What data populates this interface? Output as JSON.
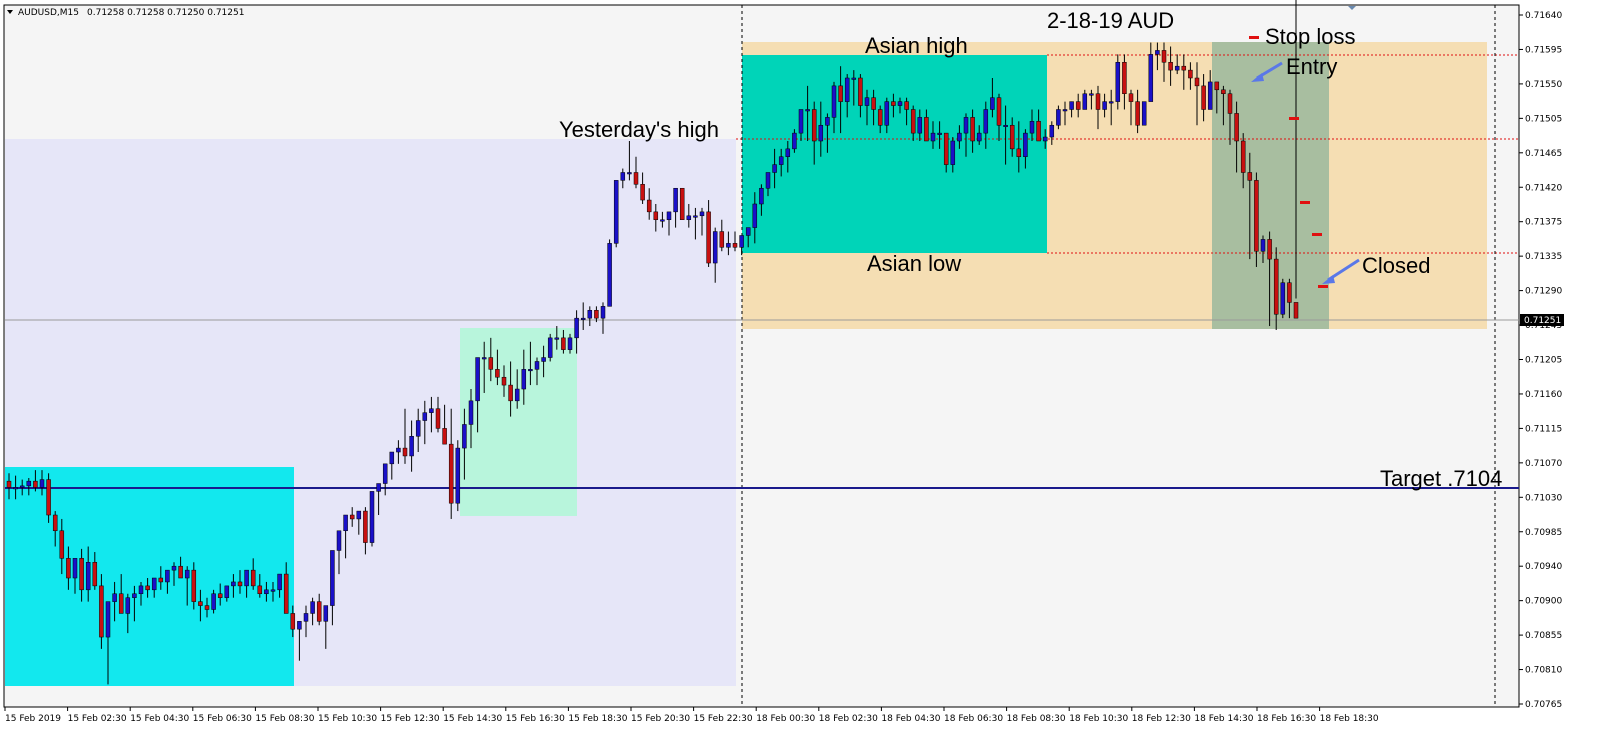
{
  "window": {
    "symbol_label": "AUDUSD,M15",
    "ohlc_label": "0.71258 0.71258 0.71250 0.71251",
    "current_price_label": "0.71251"
  },
  "chart_data": {
    "type": "candlestick",
    "symbol": "AUDUSD",
    "timeframe": "M15",
    "title": "2-18-19  AUD",
    "ylim": [
      0.7075,
      0.71665
    ],
    "y_ticks": [
      "0.71640",
      "0.71595",
      "0.71550",
      "0.71505",
      "0.71465",
      "0.71420",
      "0.71375",
      "0.71335",
      "0.71290",
      "0.71245",
      "0.71205",
      "0.71160",
      "0.71115",
      "0.71070",
      "0.71030",
      "0.70985",
      "0.70940",
      "0.70900",
      "0.70855",
      "0.70810",
      "0.70765"
    ],
    "x_tick_labels": [
      "15 Feb 2019",
      "15 Feb 02:30",
      "15 Feb 04:30",
      "15 Feb 06:30",
      "15 Feb 08:30",
      "15 Feb 10:30",
      "15 Feb 12:30",
      "15 Feb 14:30",
      "15 Feb 16:30",
      "15 Feb 18:30",
      "15 Feb 20:30",
      "15 Feb 22:30",
      "18 Feb 00:30",
      "18 Feb 02:30",
      "18 Feb 04:30",
      "18 Feb 06:30",
      "18 Feb 08:30",
      "18 Feb 10:30",
      "18 Feb 12:30",
      "18 Feb 14:30",
      "18 Feb 16:30",
      "18 Feb 18:30"
    ],
    "candles": {
      "o": [
        0.71048,
        0.7104,
        0.7104,
        0.71042,
        0.71048,
        0.7104,
        0.7105,
        0.71005,
        0.70985,
        0.7095,
        0.70925,
        0.7095,
        0.7091,
        0.70945,
        0.70915,
        0.7085,
        0.70895,
        0.70905,
        0.7088,
        0.709,
        0.70905,
        0.70915,
        0.7091,
        0.70925,
        0.7092,
        0.70935,
        0.7094,
        0.70925,
        0.70935,
        0.70895,
        0.7089,
        0.70885,
        0.70905,
        0.709,
        0.70915,
        0.7092,
        0.70915,
        0.70935,
        0.70915,
        0.70905,
        0.7091,
        0.7091,
        0.7093,
        0.7088,
        0.7086,
        0.7087,
        0.7088,
        0.70895,
        0.7087,
        0.7089,
        0.7096,
        0.70985,
        0.71005,
        0.71,
        0.7101,
        0.7097,
        0.71035,
        0.71045,
        0.7107,
        0.71085,
        0.7109,
        0.7108,
        0.71105,
        0.71125,
        0.71135,
        0.7114,
        0.71115,
        0.71095,
        0.7102,
        0.7109,
        0.7112,
        0.7115,
        0.71205,
        0.71205,
        0.7119,
        0.7118,
        0.7117,
        0.7115,
        0.71165,
        0.7119,
        0.7119,
        0.712,
        0.71205,
        0.7123,
        0.7123,
        0.71215,
        0.7123,
        0.71255,
        0.71255,
        0.71265,
        0.71255,
        0.7127,
        0.7135,
        0.7143,
        0.7144,
        0.7144,
        0.71425,
        0.71405,
        0.7139,
        0.7138,
        0.7138,
        0.7139,
        0.7142,
        0.7138,
        0.71385,
        0.71385,
        0.7139,
        0.71325,
        0.71365,
        0.71345,
        0.7135,
        0.71345,
        0.7136,
        0.7137,
        0.714,
        0.7142,
        0.7144,
        0.7145,
        0.7146,
        0.7147,
        0.7149,
        0.7152,
        0.7152,
        0.7148,
        0.715,
        0.7151,
        0.7155,
        0.7153,
        0.7156,
        0.7156,
        0.71525,
        0.71535,
        0.7152,
        0.715,
        0.7153,
        0.71525,
        0.7153,
        0.7152,
        0.7149,
        0.7151,
        0.7148,
        0.7149,
        0.7149,
        0.7145,
        0.7148,
        0.7149,
        0.7151,
        0.7148,
        0.7149,
        0.7152,
        0.71535,
        0.715,
        0.715,
        0.7147,
        0.7146,
        0.7149,
        0.71505,
        0.7148,
        0.71485,
        0.715,
        0.7152,
        0.7152,
        0.7153,
        0.7152,
        0.7154,
        0.7154,
        0.7152,
        0.7153,
        0.7153,
        0.7158,
        0.7154,
        0.7153,
        0.715,
        0.7153,
        0.7159,
        0.71595,
        0.7158,
        0.7157,
        0.71575,
        0.7157,
        0.7156,
        0.7155,
        0.7152,
        0.71555,
        0.71545,
        0.7154,
        0.71515,
        0.7148,
        0.7144,
        0.7143,
        0.7134,
        0.71355,
        0.7133,
        0.7126,
        0.713,
        0.71275
      ],
      "h": [
        0.71058,
        0.71055,
        0.7105,
        0.71052,
        0.71062,
        0.71062,
        0.71058,
        0.7101,
        0.71,
        0.70965,
        0.70935,
        0.70962,
        0.70965,
        0.70958,
        0.7093,
        0.7088,
        0.7092,
        0.7093,
        0.70905,
        0.70915,
        0.7092,
        0.70925,
        0.70925,
        0.7094,
        0.70935,
        0.70945,
        0.70952,
        0.7094,
        0.70945,
        0.7091,
        0.709,
        0.7091,
        0.70918,
        0.70915,
        0.7093,
        0.70935,
        0.7093,
        0.7095,
        0.7093,
        0.7092,
        0.7092,
        0.70925,
        0.70945,
        0.7089,
        0.7087,
        0.7089,
        0.709,
        0.70905,
        0.70885,
        0.70905,
        0.70975,
        0.71005,
        0.71015,
        0.7101,
        0.71015,
        0.7101,
        0.71045,
        0.7106,
        0.71085,
        0.711,
        0.7114,
        0.71125,
        0.7114,
        0.7115,
        0.71155,
        0.71155,
        0.71145,
        0.7114,
        0.711,
        0.7114,
        0.71165,
        0.712,
        0.71225,
        0.7123,
        0.71215,
        0.71195,
        0.712,
        0.7119,
        0.71215,
        0.71225,
        0.71205,
        0.7122,
        0.71235,
        0.71245,
        0.7124,
        0.71235,
        0.71265,
        0.71275,
        0.7127,
        0.7127,
        0.71275,
        0.71355,
        0.7143,
        0.71445,
        0.7148,
        0.7146,
        0.7144,
        0.7142,
        0.714,
        0.7139,
        0.7139,
        0.7142,
        0.7142,
        0.714,
        0.71395,
        0.71395,
        0.71405,
        0.7137,
        0.7138,
        0.71365,
        0.71365,
        0.7136,
        0.7137,
        0.71415,
        0.71425,
        0.7144,
        0.7147,
        0.7147,
        0.7148,
        0.71495,
        0.7152,
        0.7155,
        0.7153,
        0.7153,
        0.71515,
        0.71555,
        0.71575,
        0.71565,
        0.7157,
        0.71565,
        0.71545,
        0.71545,
        0.71525,
        0.71535,
        0.7154,
        0.71535,
        0.71535,
        0.71525,
        0.7152,
        0.7152,
        0.71505,
        0.71505,
        0.7149,
        0.71485,
        0.715,
        0.71515,
        0.7152,
        0.715,
        0.7153,
        0.7156,
        0.7154,
        0.71525,
        0.7151,
        0.71505,
        0.71495,
        0.7152,
        0.7152,
        0.71495,
        0.71505,
        0.71525,
        0.7153,
        0.7153,
        0.7154,
        0.71545,
        0.71545,
        0.7155,
        0.7154,
        0.71545,
        0.7159,
        0.7159,
        0.71545,
        0.71545,
        0.7153,
        0.71605,
        0.71605,
        0.71605,
        0.716,
        0.7159,
        0.7159,
        0.7158,
        0.7158,
        0.71565,
        0.7157,
        0.71555,
        0.7155,
        0.71545,
        0.7153,
        0.7149,
        0.71465,
        0.7144,
        0.7136,
        0.71365,
        0.71345,
        0.71305,
        0.71305,
        0.7128
      ],
      "l": [
        0.71025,
        0.71025,
        0.7103,
        0.7103,
        0.71035,
        0.7103,
        0.70995,
        0.70965,
        0.7093,
        0.7091,
        0.70905,
        0.70895,
        0.70895,
        0.7091,
        0.70835,
        0.7079,
        0.7087,
        0.7089,
        0.70855,
        0.7087,
        0.7089,
        0.709,
        0.709,
        0.7091,
        0.70905,
        0.70915,
        0.70925,
        0.7089,
        0.70885,
        0.7087,
        0.70875,
        0.7088,
        0.7089,
        0.70895,
        0.709,
        0.70905,
        0.709,
        0.7091,
        0.709,
        0.70895,
        0.70895,
        0.709,
        0.7088,
        0.7085,
        0.7082,
        0.7085,
        0.70865,
        0.70865,
        0.70835,
        0.70865,
        0.7093,
        0.7095,
        0.7099,
        0.7098,
        0.70955,
        0.70965,
        0.71005,
        0.7103,
        0.7105,
        0.7107,
        0.7107,
        0.7106,
        0.71085,
        0.71095,
        0.7111,
        0.7111,
        0.7111,
        0.71,
        0.7101,
        0.7105,
        0.7109,
        0.7111,
        0.7116,
        0.71175,
        0.7117,
        0.71155,
        0.7113,
        0.7114,
        0.71145,
        0.7117,
        0.7117,
        0.7118,
        0.712,
        0.71215,
        0.7121,
        0.7121,
        0.7121,
        0.7124,
        0.71245,
        0.7125,
        0.71235,
        0.7127,
        0.71345,
        0.7142,
        0.7143,
        0.7142,
        0.714,
        0.7138,
        0.71365,
        0.7137,
        0.7136,
        0.7137,
        0.7138,
        0.7137,
        0.71355,
        0.7136,
        0.7132,
        0.713,
        0.7134,
        0.71335,
        0.7134,
        0.71335,
        0.71345,
        0.7135,
        0.71385,
        0.7141,
        0.7142,
        0.71435,
        0.7144,
        0.71465,
        0.7148,
        0.7148,
        0.7145,
        0.7146,
        0.71465,
        0.7149,
        0.7149,
        0.7151,
        0.71525,
        0.7151,
        0.715,
        0.715,
        0.7149,
        0.7149,
        0.7151,
        0.71515,
        0.715,
        0.7148,
        0.7148,
        0.7148,
        0.7147,
        0.7147,
        0.7144,
        0.7144,
        0.7147,
        0.7146,
        0.71465,
        0.71475,
        0.7147,
        0.7151,
        0.7148,
        0.7145,
        0.7146,
        0.7144,
        0.71445,
        0.7148,
        0.7148,
        0.7147,
        0.71475,
        0.71495,
        0.715,
        0.7151,
        0.7151,
        0.7152,
        0.7152,
        0.71495,
        0.7151,
        0.715,
        0.7152,
        0.7152,
        0.715,
        0.7149,
        0.715,
        0.7157,
        0.7157,
        0.71555,
        0.7155,
        0.71565,
        0.71545,
        0.71545,
        0.715,
        0.71505,
        0.7153,
        0.71515,
        0.715,
        0.71475,
        0.7144,
        0.7142,
        0.7133,
        0.7132,
        0.71325,
        0.71245,
        0.7124,
        0.71255,
        0.71255
      ],
      "c": [
        0.7104,
        0.7104,
        0.71042,
        0.71048,
        0.7104,
        0.7105,
        0.71005,
        0.70985,
        0.7095,
        0.70925,
        0.7095,
        0.7091,
        0.70945,
        0.70915,
        0.7085,
        0.70895,
        0.70905,
        0.7088,
        0.709,
        0.70905,
        0.70915,
        0.7091,
        0.70925,
        0.7092,
        0.70935,
        0.7094,
        0.70925,
        0.70935,
        0.70895,
        0.7089,
        0.70885,
        0.70905,
        0.709,
        0.70915,
        0.7092,
        0.70915,
        0.70935,
        0.70915,
        0.70905,
        0.7091,
        0.7091,
        0.7093,
        0.7088,
        0.7086,
        0.7087,
        0.7088,
        0.70895,
        0.7087,
        0.7089,
        0.7096,
        0.70985,
        0.71005,
        0.71,
        0.7101,
        0.7097,
        0.71035,
        0.71045,
        0.7107,
        0.71085,
        0.7109,
        0.7108,
        0.71105,
        0.71125,
        0.71135,
        0.7114,
        0.71115,
        0.71095,
        0.7102,
        0.7109,
        0.7112,
        0.7115,
        0.71205,
        0.71205,
        0.7119,
        0.7118,
        0.7117,
        0.7115,
        0.71165,
        0.7119,
        0.7119,
        0.712,
        0.71205,
        0.7123,
        0.7123,
        0.71215,
        0.7123,
        0.71255,
        0.71255,
        0.71265,
        0.71255,
        0.7127,
        0.7135,
        0.7143,
        0.7144,
        0.7144,
        0.71425,
        0.71405,
        0.7139,
        0.7138,
        0.7138,
        0.7139,
        0.7142,
        0.7138,
        0.71385,
        0.71385,
        0.7139,
        0.71325,
        0.71365,
        0.71345,
        0.7135,
        0.71345,
        0.7136,
        0.7137,
        0.714,
        0.7142,
        0.7144,
        0.7145,
        0.7146,
        0.7147,
        0.7149,
        0.7152,
        0.7152,
        0.7148,
        0.715,
        0.7151,
        0.7155,
        0.7153,
        0.7156,
        0.7156,
        0.71525,
        0.71535,
        0.7152,
        0.715,
        0.7153,
        0.71525,
        0.7153,
        0.7152,
        0.7149,
        0.7151,
        0.7148,
        0.7149,
        0.7149,
        0.7145,
        0.7148,
        0.7149,
        0.7151,
        0.7148,
        0.7149,
        0.7152,
        0.71535,
        0.715,
        0.715,
        0.7147,
        0.7146,
        0.7149,
        0.71505,
        0.7148,
        0.71485,
        0.715,
        0.7152,
        0.7152,
        0.7153,
        0.7152,
        0.7154,
        0.7154,
        0.7152,
        0.7153,
        0.7153,
        0.7158,
        0.7154,
        0.7153,
        0.715,
        0.7153,
        0.7159,
        0.71595,
        0.7158,
        0.7157,
        0.71575,
        0.7157,
        0.7156,
        0.7155,
        0.7152,
        0.71555,
        0.71545,
        0.7154,
        0.71515,
        0.7148,
        0.7144,
        0.7143,
        0.7134,
        0.71355,
        0.7133,
        0.7126,
        0.713,
        0.71275,
        0.71255
      ]
    },
    "levels": [
      {
        "name": "Asian high",
        "price": 0.7159
      },
      {
        "name": "Yesterday's high",
        "price": 0.7148
      },
      {
        "name": "Asian low",
        "price": 0.7134
      },
      {
        "name": "Target",
        "price": 0.7104
      },
      {
        "name": "current",
        "price": 0.71251
      }
    ],
    "annotations": {
      "title": "2-18-19  AUD",
      "asian_high": "Asian high",
      "asian_low": "Asian low",
      "yesterdays_high": "Yesterday's high",
      "stop_loss": "Stop loss",
      "entry": "Entry",
      "closed": "Closed",
      "target": "Target  .7104"
    },
    "colors": {
      "bull": "#1a10c8",
      "bear": "#c81010",
      "asian_box": "#00d4b8",
      "session_box": "#f5deb3",
      "yesterday_box": "#e6e6f8",
      "early_cyan": "#12e8ee",
      "mint_box": "#b8f5dc",
      "trade_box": "#a8bea0",
      "arrow": "#5a78e8",
      "target_line": "#1a1a8c"
    }
  }
}
